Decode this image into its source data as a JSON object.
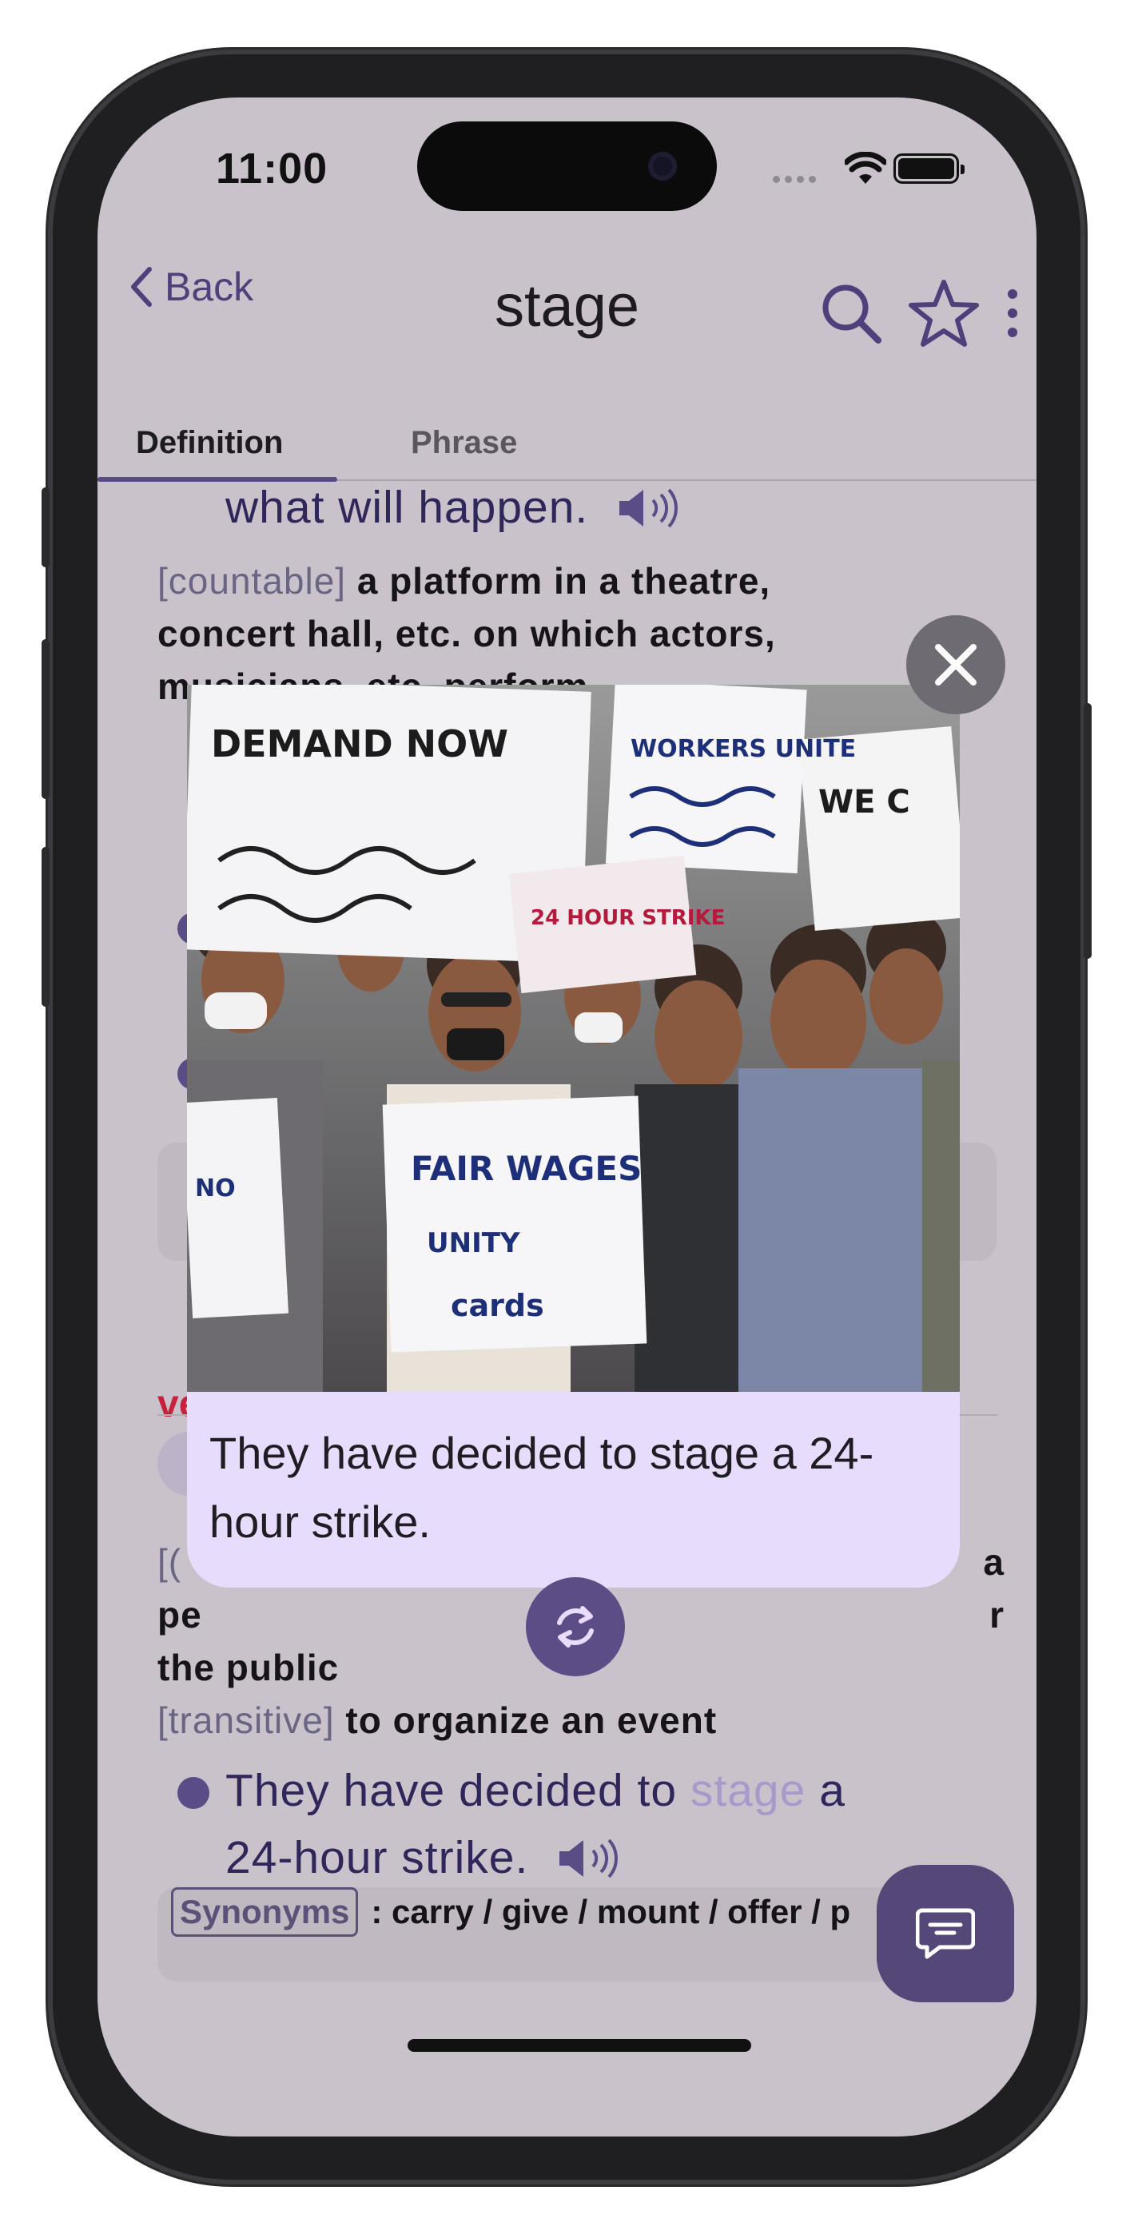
{
  "status_bar": {
    "time": "11:00"
  },
  "nav": {
    "back_label": "Back",
    "title": "stage",
    "icons": [
      "search-icon",
      "star-icon",
      "more-vertical-icon"
    ]
  },
  "tabs": [
    {
      "label": "Definition",
      "active": true
    },
    {
      "label": "Phrase",
      "active": false
    }
  ],
  "entry": {
    "prev_example_tail": "what will happen.",
    "def1_tag": "[countable]",
    "def1_text": "a platform in a theatre, concert hall, etc. on which actors, musicians, etc. perform",
    "verb_def_line1_tail": "a",
    "verb_def_line2": "pe",
    "verb_def_line2_tail": "r",
    "verb_def_line3": "the public",
    "def2_tag": "[transitive]",
    "def2_text": "to organize an event",
    "example_before": "They have decided to",
    "example_highlight": "stage",
    "example_after": "a",
    "example_line2": "24-hour strike.",
    "synonyms_label": "Synonyms",
    "synonyms_text": ": carry / give / mount / offer / p"
  },
  "popup": {
    "caption": "They have decided to stage a 24-hour strike.",
    "image_alt": "Crowd of protesters holding handwritten signs",
    "sign_texts": [
      "DEMAND NOW",
      "WORKERS UNITE",
      "24 HOUR STRIKE",
      "FAIR WAGES"
    ]
  },
  "colors": {
    "accent": "#584a82",
    "highlight": "#a79acb",
    "caption_bg": "#e7dcfb",
    "verb_red": "#c7223c"
  }
}
